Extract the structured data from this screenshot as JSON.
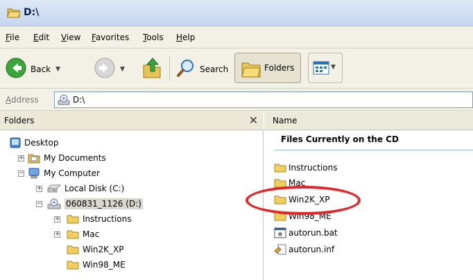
{
  "window": {
    "title": "D:\\"
  },
  "menu": [
    "File",
    "Edit",
    "View",
    "Favorites",
    "Tools",
    "Help"
  ],
  "toolbar": {
    "back": "Back",
    "search": "Search",
    "folders": "Folders"
  },
  "address": {
    "label": "Address",
    "value": "D:\\"
  },
  "folders_pane": {
    "title": "Folders",
    "tree": [
      {
        "label": "Desktop",
        "icon": "desktop-icon"
      },
      {
        "label": "My Documents",
        "icon": "documents-folder-icon"
      },
      {
        "label": "My Computer",
        "icon": "computer-icon"
      },
      {
        "label": "Local Disk (C:)",
        "icon": "hard-disk-icon"
      },
      {
        "label": "060831_1126 (D:)",
        "icon": "cd-drive-icon"
      },
      {
        "label": "Instructions",
        "icon": "folder-icon"
      },
      {
        "label": "Mac",
        "icon": "folder-icon"
      },
      {
        "label": "Win2K_XP",
        "icon": "folder-icon"
      },
      {
        "label": "Win98_ME",
        "icon": "folder-icon"
      }
    ]
  },
  "files_pane": {
    "column_name": "Name",
    "group_title": "Files Currently on the CD",
    "files": [
      {
        "name": "Instructions",
        "icon": "folder-icon"
      },
      {
        "name": "Mac",
        "icon": "folder-icon"
      },
      {
        "name": "Win2K_XP",
        "icon": "folder-icon"
      },
      {
        "name": "Win98_ME",
        "icon": "folder-icon"
      },
      {
        "name": "autorun.bat",
        "icon": "batch-file-icon"
      },
      {
        "name": "autorun.inf",
        "icon": "setup-info-file-icon"
      }
    ]
  },
  "colors": {
    "highlight": "#e0282b",
    "folder": "#f2cf5a"
  }
}
